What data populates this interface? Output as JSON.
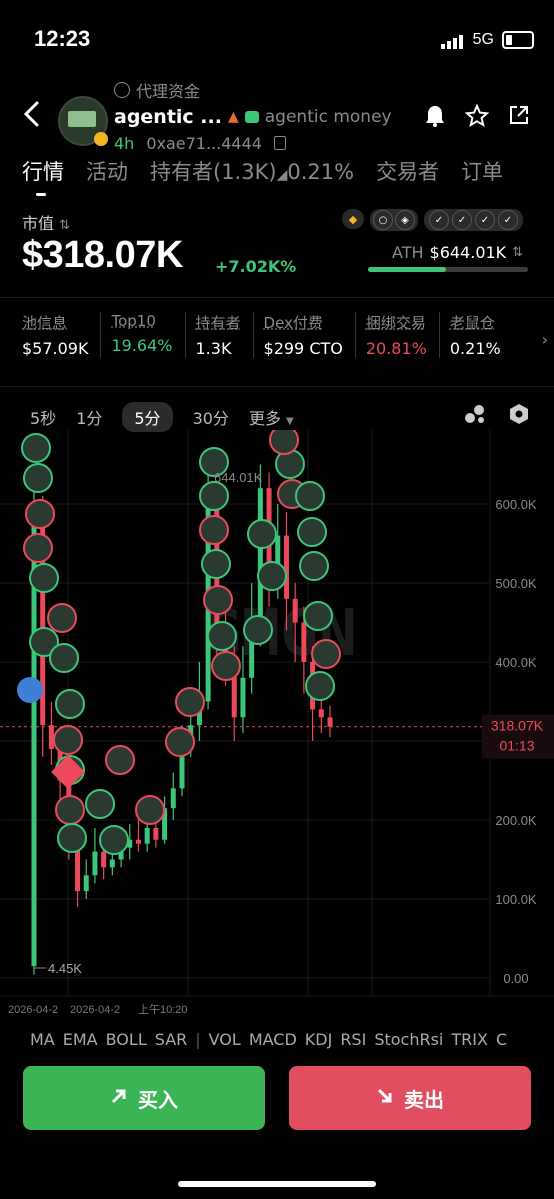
{
  "status_bar": {
    "time": "12:23",
    "network": "5G"
  },
  "header": {
    "proxy_label": "代理资金",
    "token_name": "agentic ...",
    "token_full": "agentic money",
    "age": "4h",
    "address": "0xae71...4444"
  },
  "tabs": [
    {
      "label": "行情"
    },
    {
      "label": "活动"
    },
    {
      "label": "持有者(1.3K)"
    },
    {
      "label": "0.21%"
    },
    {
      "label": "交易者"
    },
    {
      "label": "订单"
    }
  ],
  "market": {
    "cap_label": "市值",
    "cap_value": "$318.07K",
    "change": "+7.02K%",
    "ath_label": "ATH",
    "ath_value": "$644.01K",
    "ath_progress": 0.49
  },
  "stats": [
    {
      "label": "池信息",
      "value": "$57.09K",
      "color": "#ffffff"
    },
    {
      "label": "Top10",
      "value": "19.64%",
      "color": "#3cc67a"
    },
    {
      "label": "持有者",
      "value": "1.3K",
      "color": "#ffffff"
    },
    {
      "label": "Dex付费",
      "value": "$299 CTO",
      "color": "#ffffff"
    },
    {
      "label": "捆绑交易",
      "value": "20.81%",
      "color": "#ec4a5c"
    },
    {
      "label": "老鼠仓",
      "value": "0.21%",
      "color": "#ffffff"
    }
  ],
  "timeframes": [
    "5秒",
    "1分",
    "5分",
    "30分",
    "更多"
  ],
  "selected_timeframe": "5分",
  "chart_data": {
    "type": "candlestick",
    "y_ticks": [
      "600.0K",
      "500.0K",
      "400.0K",
      "300.0K",
      "200.0K",
      "100.0K",
      "0.00"
    ],
    "ylim": [
      0,
      650000
    ],
    "high_label": "644.01K",
    "low_label": "4.45K",
    "current_price_label": "318.07K",
    "countdown": "01:13",
    "x_labels": [
      "2026-04-2",
      "2026-04-2",
      "上午10:20"
    ],
    "candles": [
      {
        "o": 15,
        "c": 600,
        "h": 630,
        "l": 4.45
      },
      {
        "o": 600,
        "c": 320,
        "h": 610,
        "l": 280
      },
      {
        "o": 320,
        "c": 290,
        "h": 350,
        "l": 270
      },
      {
        "o": 290,
        "c": 250,
        "h": 300,
        "l": 210
      },
      {
        "o": 250,
        "c": 180,
        "h": 260,
        "l": 150
      },
      {
        "o": 180,
        "c": 110,
        "h": 190,
        "l": 90
      },
      {
        "o": 110,
        "c": 130,
        "h": 150,
        "l": 100
      },
      {
        "o": 130,
        "c": 160,
        "h": 190,
        "l": 120
      },
      {
        "o": 160,
        "c": 140,
        "h": 175,
        "l": 125
      },
      {
        "o": 140,
        "c": 150,
        "h": 170,
        "l": 130
      },
      {
        "o": 150,
        "c": 165,
        "h": 180,
        "l": 140
      },
      {
        "o": 165,
        "c": 175,
        "h": 195,
        "l": 150
      },
      {
        "o": 175,
        "c": 170,
        "h": 205,
        "l": 160
      },
      {
        "o": 170,
        "c": 190,
        "h": 210,
        "l": 160
      },
      {
        "o": 190,
        "c": 175,
        "h": 205,
        "l": 165
      },
      {
        "o": 175,
        "c": 215,
        "h": 230,
        "l": 170
      },
      {
        "o": 215,
        "c": 240,
        "h": 260,
        "l": 200
      },
      {
        "o": 240,
        "c": 300,
        "h": 320,
        "l": 230
      },
      {
        "o": 300,
        "c": 320,
        "h": 345,
        "l": 280
      },
      {
        "o": 320,
        "c": 350,
        "h": 400,
        "l": 300
      },
      {
        "o": 350,
        "c": 600,
        "h": 644.01,
        "l": 340
      },
      {
        "o": 600,
        "c": 420,
        "h": 620,
        "l": 380
      },
      {
        "o": 420,
        "c": 390,
        "h": 470,
        "l": 370
      },
      {
        "o": 390,
        "c": 330,
        "h": 420,
        "l": 300
      },
      {
        "o": 330,
        "c": 380,
        "h": 420,
        "l": 310
      },
      {
        "o": 380,
        "c": 440,
        "h": 500,
        "l": 360
      },
      {
        "o": 440,
        "c": 620,
        "h": 650,
        "l": 420
      },
      {
        "o": 620,
        "c": 520,
        "h": 640,
        "l": 470
      },
      {
        "o": 520,
        "c": 560,
        "h": 600,
        "l": 480
      },
      {
        "o": 560,
        "c": 480,
        "h": 590,
        "l": 440
      },
      {
        "o": 480,
        "c": 450,
        "h": 500,
        "l": 400
      },
      {
        "o": 450,
        "c": 400,
        "h": 470,
        "l": 360
      },
      {
        "o": 400,
        "c": 340,
        "h": 420,
        "l": 300
      },
      {
        "o": 340,
        "c": 330,
        "h": 370,
        "l": 310
      },
      {
        "o": 330,
        "c": 318.07,
        "h": 345,
        "l": 305
      }
    ]
  },
  "indicators": [
    "MA",
    "EMA",
    "BOLL",
    "SAR",
    "VOL",
    "MACD",
    "KDJ",
    "RSI",
    "StochRsi",
    "TRIX",
    "C"
  ],
  "actions": {
    "buy": "买入",
    "sell": "卖出"
  },
  "colors": {
    "up": "#3cc67a",
    "down": "#ec4a5c",
    "buy_bg": "#3ab455",
    "sell_bg": "#e04e60"
  }
}
